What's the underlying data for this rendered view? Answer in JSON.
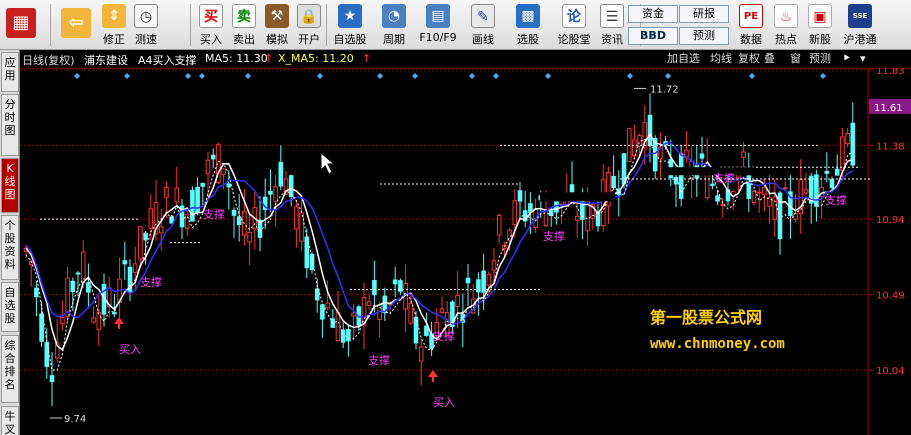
{
  "toolbar": {
    "buttons": [
      {
        "label": "",
        "icon": "grid-icon"
      },
      {
        "label": "",
        "icon": "back-arrow-icon"
      },
      {
        "label": "修正",
        "icon": "up-down-arrow-icon"
      },
      {
        "label": "测速",
        "icon": "stopwatch-icon"
      },
      {
        "label": "买入",
        "icon": "buy-icon",
        "glyph": "买"
      },
      {
        "label": "卖出",
        "icon": "sell-icon",
        "glyph": "卖"
      },
      {
        "label": "模拟",
        "icon": "hammer-icon"
      },
      {
        "label": "开户",
        "icon": "lock-icon"
      },
      {
        "label": "自选股",
        "icon": "star-list-icon"
      },
      {
        "label": "周期",
        "icon": "clock-icon"
      },
      {
        "label": "F10/F9",
        "icon": "f10-icon"
      },
      {
        "label": "画线",
        "icon": "pen-icon"
      },
      {
        "label": "选股",
        "icon": "chart-select-icon"
      },
      {
        "label": "论股堂",
        "icon": "forum-icon",
        "glyph": "论"
      },
      {
        "label": "资讯",
        "icon": "news-icon"
      },
      {
        "label": "数据",
        "icon": "pe-icon",
        "glyph": "PE"
      },
      {
        "label": "热点",
        "icon": "hot-icon"
      },
      {
        "label": "新股",
        "icon": "new-stock-icon"
      },
      {
        "label": "沪港通",
        "icon": "sse-hkex-icon",
        "glyph": "SSE HKE"
      }
    ],
    "small_buttons": [
      "资金",
      "研报",
      "BBD",
      "预测"
    ]
  },
  "sidebar": {
    "tabs": [
      "应用",
      "分时图",
      "K线图",
      "个股资料",
      "自选股",
      "综合排名",
      "牛叉"
    ]
  },
  "chart_header": {
    "period": "日线(复权)",
    "stock": "浦东建设",
    "indicator": "A4买入支撑",
    "ma5": "MA5: 11.30",
    "x_ma5": "X_MA5: 11.20",
    "controls": [
      "加自选",
      "均线",
      "复权",
      "叠",
      "窗",
      "预测"
    ]
  },
  "chart": {
    "price_ticks": [
      "11.83",
      "11.38",
      "10.94",
      "10.49",
      "10.04"
    ],
    "current_price": "11.61",
    "high_label": "11.72",
    "low_label": "9.74",
    "annotations": {
      "support": "支撑",
      "buy": "买入"
    },
    "watermark_line1": "第一股票公式网",
    "watermark_line2": "www.chnmoney.com",
    "colors": {
      "up": "#ff3030",
      "down": "#54ffff",
      "ma_white": "#ffffff",
      "ma_blue": "#3030ff",
      "magenta": "#ff40ff",
      "yellow": "#ffff40",
      "watermark": "#ffd000",
      "axis": "#b00000"
    }
  }
}
